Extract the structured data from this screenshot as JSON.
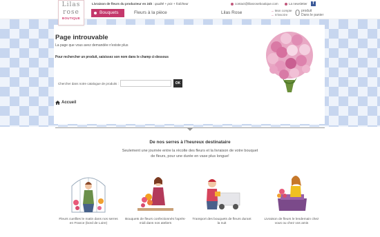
{
  "header": {
    "logo": {
      "line1": "Lilas",
      "line2": "rose",
      "line3": "BOUTIQUE"
    },
    "tagline": {
      "bold": "Livraison de fleurs du producteur en 24h",
      "sep": " : ",
      "italic": "qualité + prix + fraîcheur"
    },
    "contact": "contact@lilasroseboutique.com",
    "newsletter": "La newsletter",
    "facebook_icon": "facebook-icon",
    "nav": [
      "Bouquets",
      "Fleurs à la pièce",
      "Lilas Rose"
    ],
    "account": {
      "line1": "Mon compte",
      "line2": "S'inscrire"
    },
    "cart": {
      "count": "0",
      "line1": "produit",
      "line2": "Dans le panier"
    }
  },
  "main": {
    "title": "Page introuvable",
    "subtitle": "La page que vous avez demandée n'existe plus",
    "instruction": "Pour rechercher un produit, saisissez son nom dans le champ ci-dessous",
    "search_label": "Chercher dans notre catalogue de produits :",
    "search_value": "",
    "search_button": "OK",
    "home_link": "Accueil"
  },
  "section": {
    "title": "De nos serres à l'heureux destinataire",
    "text": "Seulement une journée entre la récolte des fleurs et la livraison de votre bouquet de fleurs, pour une durée en vase plus longue!",
    "steps": [
      {
        "caption": "Fleurs cueillies le matin dans nos serres en France (bord de Loire)"
      },
      {
        "caption": "Bouquets de fleurs confectionnés l'après-midi dans nos ateliers"
      },
      {
        "caption": "Transport des bouquets de fleurs durant la nuit"
      },
      {
        "caption": "Livraison de fleurs le lendemain chez vous ou chez vos amis"
      }
    ]
  },
  "colors": {
    "accent": "#c4386b",
    "check": "#a8bee6",
    "dark_button": "#2e2e2e"
  }
}
